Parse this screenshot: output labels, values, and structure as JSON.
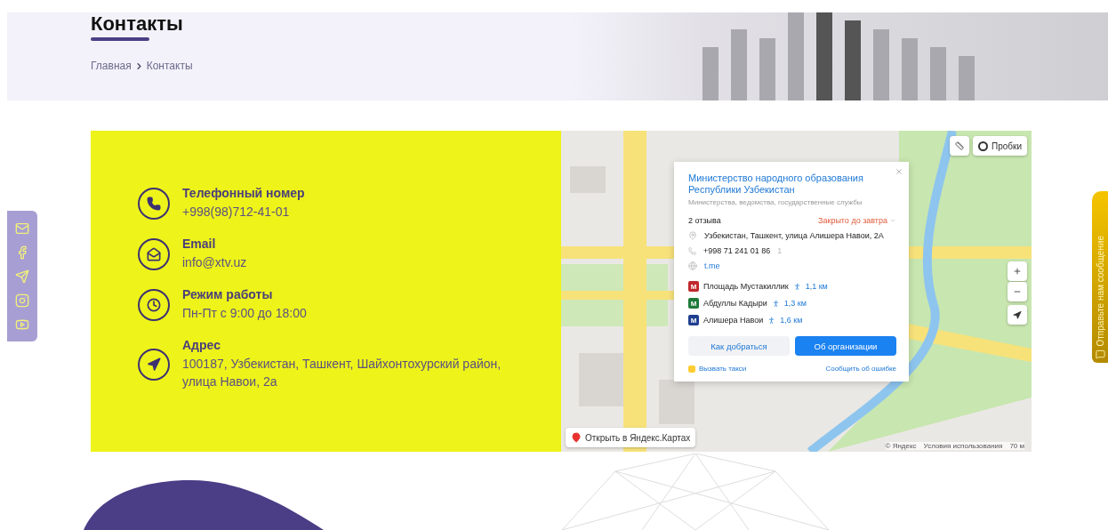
{
  "page_header": {
    "title": "Контакты",
    "breadcrumbs": [
      {
        "label": "Главная"
      },
      {
        "label": "Контакты"
      }
    ]
  },
  "contacts": [
    {
      "kind": "phone",
      "label": "Телефонный номер",
      "value": "+998(98)712-41-01"
    },
    {
      "kind": "email",
      "label": "Email",
      "value": "info@xtv.uz"
    },
    {
      "kind": "clock",
      "label": "Режим работы",
      "value": "Пн-Пт с 9:00 до 18:00"
    },
    {
      "kind": "location",
      "label": "Адрес",
      "value": "100187, Узбекистан, Ташкент, Шайхонтохурский район, улица Навои, 2а"
    }
  ],
  "map": {
    "traffic_button": "Пробки",
    "open_link": "Открыть в Яндекс.Картах",
    "copyright": "© Яндекс",
    "terms": "Условия использования",
    "scale": "70 м",
    "card": {
      "title": "Министерство народного образования Республики Узбекистан",
      "category": "Министерства, ведомства, государственные службы",
      "reviews": "2 отзыва",
      "hours_status": "Закрыто до завтра",
      "address": "Узбекистан, Ташкент, улица Алишера Навои, 2А",
      "phone": "+998 71 241 01 86",
      "phone_extra": "1",
      "website": "t.me",
      "metro": [
        {
          "badge": "M",
          "name": "Площадь Мустакиллик",
          "distance": "1,1 км",
          "color": "#c0282d"
        },
        {
          "badge": "M",
          "name": "Абдуллы Кадыри",
          "distance": "1,3 км",
          "color": "#1f7a3a"
        },
        {
          "badge": "M",
          "name": "Алишера Навои",
          "distance": "1,6 км",
          "color": "#1f3f8f"
        }
      ],
      "route_button": "Как добраться",
      "about_button": "Об организации",
      "taxi_link": "Вызвать такси",
      "report_link": "Сообщить об ошибке"
    }
  },
  "feedback_tab": {
    "label": "Отправьте нам сообщение"
  }
}
